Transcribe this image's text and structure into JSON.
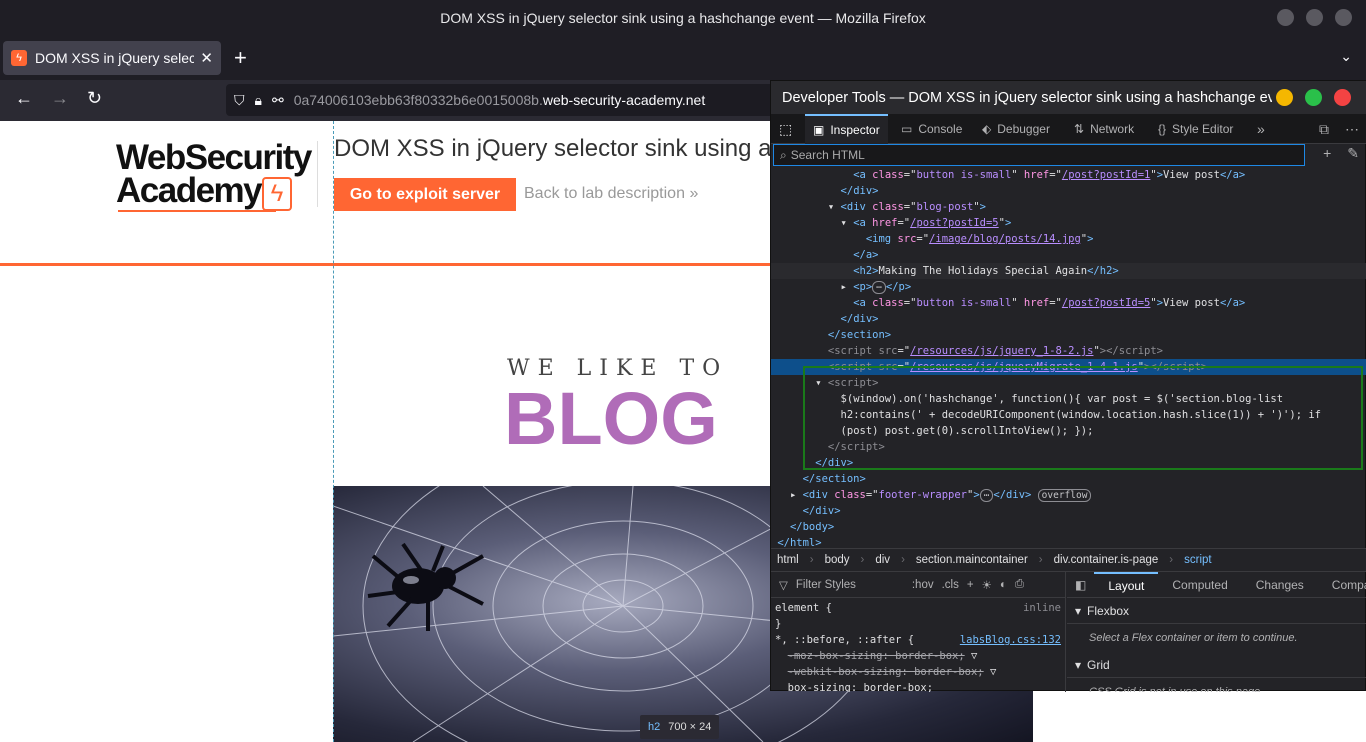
{
  "window": {
    "title": "DOM XSS in jQuery selector sink using a hashchange event — Mozilla Firefox"
  },
  "tab": {
    "title": "DOM XSS in jQuery select",
    "close": "✕"
  },
  "url": {
    "prefix": "0a74006103ebb63f80332b6e0015008b.",
    "domain": "web-security-academy.net"
  },
  "page": {
    "logo_line1": "WebSecurity",
    "logo_line2": "Academy",
    "lab_title": "DOM XSS in jQuery selector sink using a hashchange event",
    "exploit_button": "Go to exploit server",
    "back_link": "Back to lab description",
    "tagline": "WE LIKE TO",
    "blog_word": "BLOG",
    "highlight_tag": "h2",
    "highlight_size": "700 × 24"
  },
  "devtools": {
    "title": "Developer Tools — DOM XSS in jQuery selector sink using a hashchange event",
    "tabs": [
      "Inspector",
      "Console",
      "Debugger",
      "Network",
      "Style Editor"
    ],
    "search_placeholder": "Search HTML",
    "markup": {
      "r0_cls": "button is-small",
      "r0_href": "/post?postId=1",
      "r0_text": "View post",
      "r2_cls": "blog-post",
      "r3_href": "/post?postId=5",
      "r4_src": "/image/blog/posts/14.jpg",
      "r6_text": "Making The Holidays Special Again",
      "r8_cls": "button is-small",
      "r8_href": "/post?postId=5",
      "r8_text": "View post",
      "r11_src": "/resources/js/jquery_1-8-2.js",
      "r12_src": "/resources/js/jqueryMigrate_1-4-1.js",
      "script_l1": "$(window).on('hashchange', function(){ var post = $('section.blog-list",
      "script_l2": "h2:contains(' + decodeURIComponent(window.location.hash.slice(1)) + ')'); if",
      "script_l3": "(post) post.get(0).scrollIntoView(); });",
      "r19_cls": "footer-wrapper",
      "overflow_badge": "overflow"
    },
    "breadcrumbs": [
      "html",
      "body",
      "div",
      "section.maincontainer",
      "div.container.is-page",
      "script"
    ],
    "rules": {
      "filter_placeholder": "Filter Styles",
      "hov": ":hov",
      "cls": ".cls",
      "element_rule": "element {",
      "inline": "inline",
      "close_brace": "}",
      "universal_selector": "*, ::before, ::after {",
      "universal_source": "labsBlog.css:132",
      "decl1": "-moz-box-sizing: border-box;",
      "decl2": "-webkit-box-sizing: border-box;",
      "decl3": "box-sizing: border-box;"
    },
    "layout": {
      "tabs": [
        "Layout",
        "Computed",
        "Changes",
        "Compat"
      ],
      "flexbox_header": "Flexbox",
      "flexbox_msg": "Select a Flex container or item to continue.",
      "grid_header": "Grid",
      "grid_msg": "CSS Grid is not in use on this page"
    }
  },
  "colors": {
    "accent": "#ff6633",
    "blog_purple": "#b06cb8",
    "devtools_bg": "#232327",
    "selection": "#0d4f8b",
    "highlight_box": "#1a7a1a"
  }
}
